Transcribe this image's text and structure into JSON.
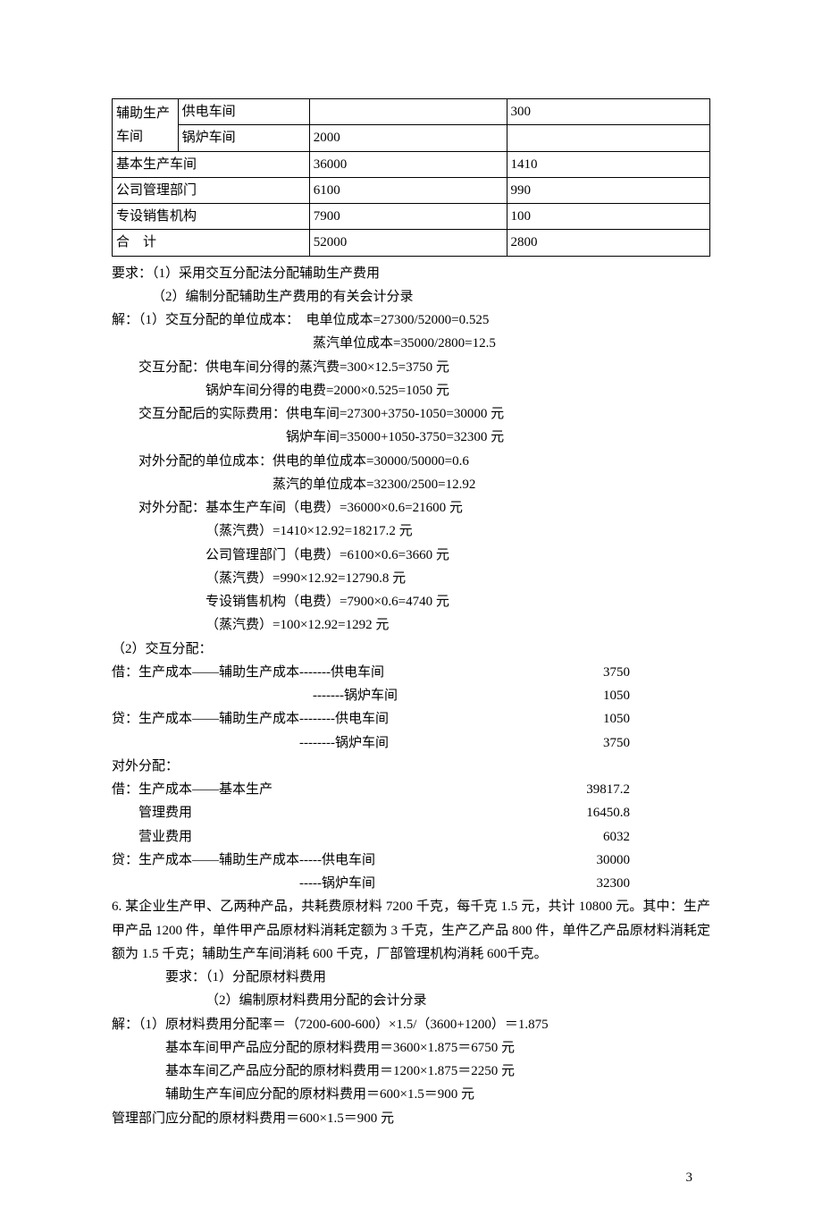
{
  "table": {
    "rows": [
      {
        "a": "辅助生产车间",
        "b": "供电车间",
        "c": "",
        "d": "300",
        "rowspan": true
      },
      {
        "a": "",
        "b": "锅炉车间",
        "c": "2000",
        "d": ""
      },
      {
        "ab": "基本生产车间",
        "c": "36000",
        "d": "1410"
      },
      {
        "ab": "公司管理部门",
        "c": "6100",
        "d": "990"
      },
      {
        "ab": "专设销售机构",
        "c": "7900",
        "d": "100"
      },
      {
        "ab": "合　计",
        "c": "52000",
        "d": "2800"
      }
    ]
  },
  "req": {
    "line1": "要求：（1）采用交互分配法分配辅助生产费用",
    "line2": "（2）编制分配辅助生产费用的有关会计分录"
  },
  "sol": {
    "l1": "解：（1）交互分配的单位成本：　电单位成本=27300/52000=0.525",
    "l2": "蒸汽单位成本=35000/2800=12.5",
    "l3": "交互分配：供电车间分得的蒸汽费=300×12.5=3750 元",
    "l4": "锅炉车间分得的电费=2000×0.525=1050 元",
    "l5": "交互分配后的实际费用：供电车间=27300+3750-1050=30000 元",
    "l6": "锅炉车间=35000+1050-3750=32300 元",
    "l7": "对外分配的单位成本：供电的单位成本=30000/50000=0.6",
    "l8": "蒸汽的单位成本=32300/2500=12.92",
    "l9": "对外分配：基本生产车间（电费）=36000×0.6=21600 元",
    "l10": "（蒸汽费）=1410×12.92=18217.2 元",
    "l11": "公司管理部门（电费）=6100×0.6=3660 元",
    "l12": "（蒸汽费）=990×12.92=12790.8 元",
    "l13": "专设销售机构（电费）=7900×0.6=4740 元",
    "l14": "（蒸汽费）=100×12.92=1292 元"
  },
  "part2": {
    "title": "（2）交互分配：",
    "e1": {
      "text": "借：生产成本——辅助生产成本-------供电车间",
      "amt": "3750"
    },
    "e2": {
      "text": "　　　　　　　　　　　　　　　-------锅炉车间",
      "amt": "1050"
    },
    "e3": {
      "text": "贷：生产成本——辅助生产成本--------供电车间",
      "amt": "1050"
    },
    "e4": {
      "text": "　　　　　　　　　　　　　　--------锅炉车间",
      "amt": "3750"
    },
    "ext_title": "对外分配：",
    "e5": {
      "text": "借：生产成本——基本生产",
      "amt": "39817.2"
    },
    "e6": {
      "text": "　　管理费用",
      "amt": "16450.8"
    },
    "e7": {
      "text": "　　营业费用",
      "amt": " 6032"
    },
    "e8": {
      "text": "贷：生产成本——辅助生产成本-----供电车间",
      "amt": "30000"
    },
    "e9": {
      "text": "　　　　　　　　　　　　　　-----锅炉车间",
      "amt": "32300"
    }
  },
  "q6": {
    "p1": "6. 某企业生产甲、乙两种产品，共耗费原材料 7200 千克，每千克 1.5 元，共计 10800 元。其中：生产甲产品 1200 件，单件甲产品原材料消耗定额为 3 千克，生产乙产品 800 件，单件乙产品原材料消耗定额为 1.5 千克；辅助生产车间消耗 600 千克，厂部管理机构消耗 600千克。",
    "req1": "要求：（1）分配原材料费用",
    "req2": "（2）编制原材料费用分配的会计分录",
    "s1": "解：（1）原材料费用分配率＝（7200-600-600）×1.5/（3600+1200）＝1.875",
    "s2": "基本车间甲产品应分配的原材料费用＝3600×1.875＝6750 元",
    "s3": "基本车间乙产品应分配的原材料费用＝1200×1.875＝2250 元",
    "s4": "辅助生产车间应分配的原材料费用＝600×1.5＝900 元",
    "s5": "管理部门应分配的原材料费用＝600×1.5＝900 元"
  },
  "page": "3"
}
